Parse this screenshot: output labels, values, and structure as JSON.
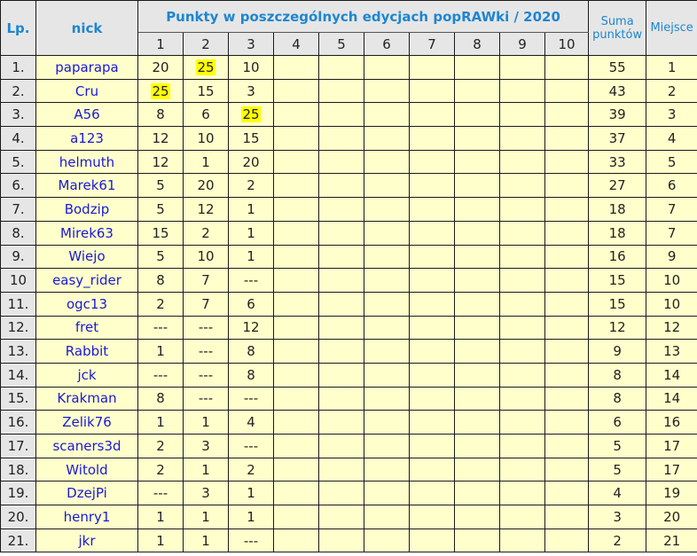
{
  "header": {
    "lp": "Lp.",
    "nick": "nick",
    "group_title": "Punkty w poszczególnych edycjach popRAWki / 2020",
    "editions": [
      "1",
      "2",
      "3",
      "4",
      "5",
      "6",
      "7",
      "8",
      "9",
      "10"
    ],
    "suma_line1": "Suma",
    "suma_line2": "punktów",
    "miejsce": "Miejsce"
  },
  "colors": {
    "header_bg": "#e6e6e6",
    "header_text": "#1e86d0",
    "row_bg": "#ffffcc",
    "nick_text": "#1a1ad6",
    "highlight": "#ffff00"
  },
  "rows": [
    {
      "lp": "1.",
      "nick": "paparapa",
      "scores": [
        "20",
        "25",
        "10",
        "",
        "",
        "",
        "",
        "",
        "",
        ""
      ],
      "highlight": [
        1
      ],
      "suma": "55",
      "miejsce": "1"
    },
    {
      "lp": "2.",
      "nick": "Cru",
      "scores": [
        "25",
        "15",
        "3",
        "",
        "",
        "",
        "",
        "",
        "",
        ""
      ],
      "highlight": [
        0
      ],
      "suma": "43",
      "miejsce": "2"
    },
    {
      "lp": "3.",
      "nick": "A56",
      "scores": [
        "8",
        "6",
        "25",
        "",
        "",
        "",
        "",
        "",
        "",
        ""
      ],
      "highlight": [
        2
      ],
      "suma": "39",
      "miejsce": "3"
    },
    {
      "lp": "4.",
      "nick": "a123",
      "scores": [
        "12",
        "10",
        "15",
        "",
        "",
        "",
        "",
        "",
        "",
        ""
      ],
      "highlight": [],
      "suma": "37",
      "miejsce": "4"
    },
    {
      "lp": "5.",
      "nick": "helmuth",
      "scores": [
        "12",
        "1",
        "20",
        "",
        "",
        "",
        "",
        "",
        "",
        ""
      ],
      "highlight": [],
      "suma": "33",
      "miejsce": "5"
    },
    {
      "lp": "6.",
      "nick": "Marek61",
      "scores": [
        "5",
        "20",
        "2",
        "",
        "",
        "",
        "",
        "",
        "",
        ""
      ],
      "highlight": [],
      "suma": "27",
      "miejsce": "6"
    },
    {
      "lp": "7.",
      "nick": "Bodzip",
      "scores": [
        "5",
        "12",
        "1",
        "",
        "",
        "",
        "",
        "",
        "",
        ""
      ],
      "highlight": [],
      "suma": "18",
      "miejsce": "7"
    },
    {
      "lp": "8.",
      "nick": "Mirek63",
      "scores": [
        "15",
        "2",
        "1",
        "",
        "",
        "",
        "",
        "",
        "",
        ""
      ],
      "highlight": [],
      "suma": "18",
      "miejsce": "7"
    },
    {
      "lp": "9.",
      "nick": "Wiejo",
      "scores": [
        "5",
        "10",
        "1",
        "",
        "",
        "",
        "",
        "",
        "",
        ""
      ],
      "highlight": [],
      "suma": "16",
      "miejsce": "9"
    },
    {
      "lp": "10",
      "nick": "easy_rider",
      "scores": [
        "8",
        "7",
        "---",
        "",
        "",
        "",
        "",
        "",
        "",
        ""
      ],
      "highlight": [],
      "suma": "15",
      "miejsce": "10"
    },
    {
      "lp": "11.",
      "nick": "ogc13",
      "scores": [
        "2",
        "7",
        "6",
        "",
        "",
        "",
        "",
        "",
        "",
        ""
      ],
      "highlight": [],
      "suma": "15",
      "miejsce": "10"
    },
    {
      "lp": "12.",
      "nick": "fret",
      "scores": [
        "---",
        "---",
        "12",
        "",
        "",
        "",
        "",
        "",
        "",
        ""
      ],
      "highlight": [],
      "suma": "12",
      "miejsce": "12"
    },
    {
      "lp": "13.",
      "nick": "Rabbit",
      "scores": [
        "1",
        "---",
        "8",
        "",
        "",
        "",
        "",
        "",
        "",
        ""
      ],
      "highlight": [],
      "suma": "9",
      "miejsce": "13"
    },
    {
      "lp": "14.",
      "nick": "jck",
      "scores": [
        "---",
        "---",
        "8",
        "",
        "",
        "",
        "",
        "",
        "",
        ""
      ],
      "highlight": [],
      "suma": "8",
      "miejsce": "14"
    },
    {
      "lp": "15.",
      "nick": "Krakman",
      "scores": [
        "8",
        "---",
        "---",
        "",
        "",
        "",
        "",
        "",
        "",
        ""
      ],
      "highlight": [],
      "suma": "8",
      "miejsce": "14"
    },
    {
      "lp": "16.",
      "nick": "Zelik76",
      "scores": [
        "1",
        "1",
        "4",
        "",
        "",
        "",
        "",
        "",
        "",
        ""
      ],
      "highlight": [],
      "suma": "6",
      "miejsce": "16"
    },
    {
      "lp": "17.",
      "nick": "scaners3d",
      "scores": [
        "2",
        "3",
        "---",
        "",
        "",
        "",
        "",
        "",
        "",
        ""
      ],
      "highlight": [],
      "suma": "5",
      "miejsce": "17"
    },
    {
      "lp": "18.",
      "nick": "Witold",
      "scores": [
        "2",
        "1",
        "2",
        "",
        "",
        "",
        "",
        "",
        "",
        ""
      ],
      "highlight": [],
      "suma": "5",
      "miejsce": "17"
    },
    {
      "lp": "19.",
      "nick": "DzejPi",
      "scores": [
        "---",
        "3",
        "1",
        "",
        "",
        "",
        "",
        "",
        "",
        ""
      ],
      "highlight": [],
      "suma": "4",
      "miejsce": "19"
    },
    {
      "lp": "20.",
      "nick": "henry1",
      "scores": [
        "1",
        "1",
        "1",
        "",
        "",
        "",
        "",
        "",
        "",
        ""
      ],
      "highlight": [],
      "suma": "3",
      "miejsce": "20"
    },
    {
      "lp": "21.",
      "nick": "jkr",
      "scores": [
        "1",
        "1",
        "---",
        "",
        "",
        "",
        "",
        "",
        "",
        ""
      ],
      "highlight": [],
      "suma": "2",
      "miejsce": "21"
    }
  ]
}
